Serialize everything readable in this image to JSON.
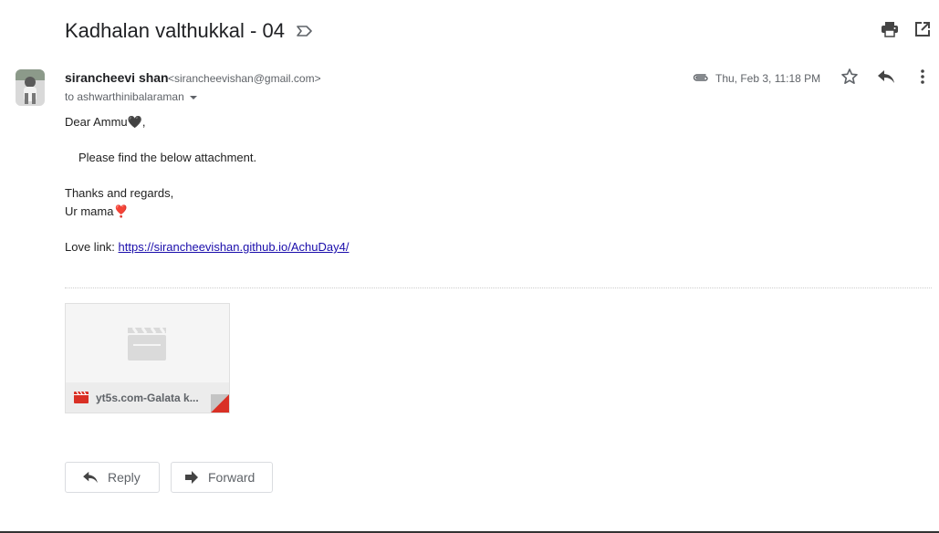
{
  "subject": "Kadhalan valthukkal - 04",
  "icons": {
    "label": "label-outline-icon",
    "print": "printer-icon",
    "popout": "open-in-new-window-icon",
    "attachment": "paperclip-icon",
    "star": "star-outline-icon",
    "reply": "reply-icon",
    "more": "more-vertical-icon",
    "video": "video-clapperboard-icon",
    "forward": "forward-icon"
  },
  "sender": {
    "name": "sirancheevi shan",
    "email": "<sirancheevishan@gmail.com>",
    "to": "to ashwarthinibalaraman"
  },
  "date": "Thu, Feb 3, 11:18 PM",
  "body": {
    "greeting": "Dear Ammu🖤,",
    "line1": "Please find the below attachment.",
    "closing": "Thanks and regards,",
    "signature": "Ur mama❣️",
    "love_link_label": "Love link: ",
    "love_link_url": "https://sirancheevishan.github.io/AchuDay4/"
  },
  "attachment": {
    "name": "yt5s.com-Galata k..."
  },
  "actions": {
    "reply": "Reply",
    "forward": "Forward"
  },
  "colors": {
    "link": "#1a0dab",
    "video_red": "#d93025",
    "text_gray": "#5f6368"
  }
}
